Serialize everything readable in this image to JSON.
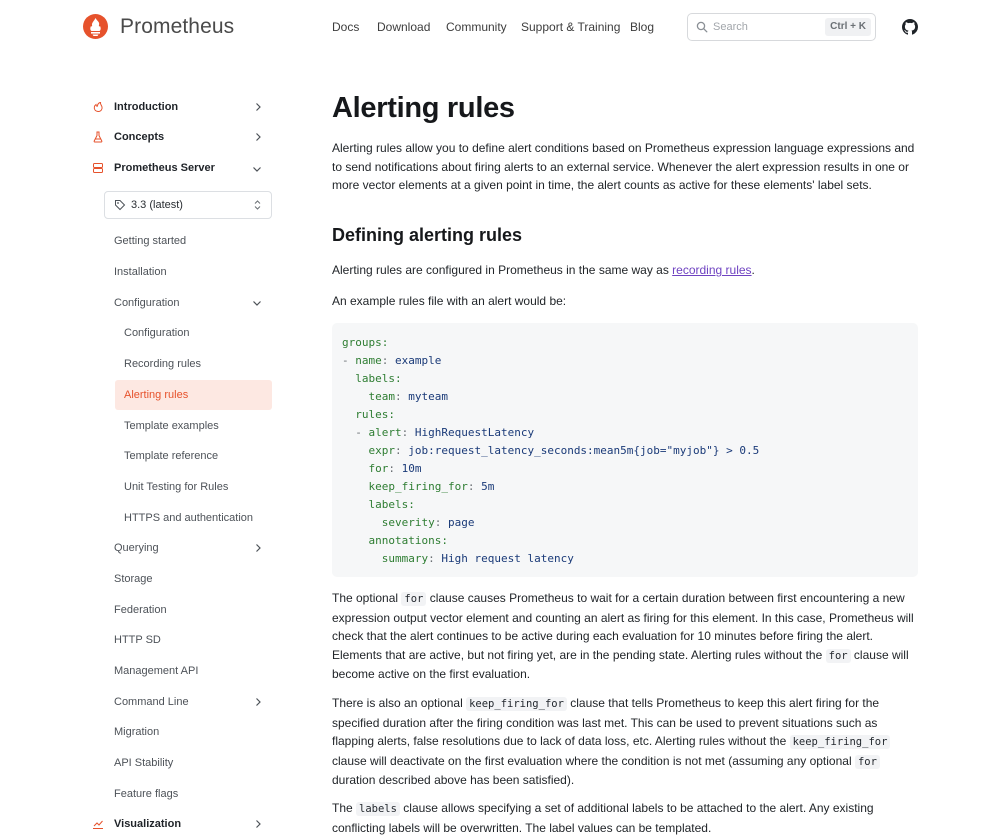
{
  "header": {
    "brand": "Prometheus",
    "nav": [
      "Docs",
      "Download",
      "Community",
      "Support & Training",
      "Blog"
    ],
    "search_placeholder": "Search",
    "search_shortcut": "Ctrl + K"
  },
  "sidebar": {
    "top": [
      {
        "label": "Introduction",
        "icon": "flame-icon"
      },
      {
        "label": "Concepts",
        "icon": "flask-icon"
      },
      {
        "label": "Prometheus Server",
        "icon": "server-icon"
      }
    ],
    "version": "3.3 (latest)",
    "items": [
      "Getting started",
      "Installation",
      "Configuration"
    ],
    "config_items": [
      "Configuration",
      "Recording rules",
      "Alerting rules",
      "Template examples",
      "Template reference",
      "Unit Testing for Rules",
      "HTTPS and authentication"
    ],
    "active": "Alerting rules",
    "rest": [
      "Querying",
      "Storage",
      "Federation",
      "HTTP SD",
      "Management API",
      "Command Line",
      "Migration",
      "API Stability",
      "Feature flags"
    ],
    "bottom": "Visualization"
  },
  "content": {
    "title": "Alerting rules",
    "intro": "Alerting rules allow you to define alert conditions based on Prometheus expression language expressions and to send notifications about firing alerts to an external service. Whenever the alert expression results in one or more vector elements at a given point in time, the alert counts as active for these elements' label sets.",
    "h2": "Defining alerting rules",
    "p1_pre": "Alerting rules are configured in Prometheus in the same way as ",
    "p1_link": "recording rules",
    "p1_post": ".",
    "p2": "An example rules file with an alert would be:",
    "code": {
      "l1": "groups:",
      "l2a": "- ",
      "l2b": "name",
      "l2c": ": ",
      "l2d": "example",
      "l3": "labels:",
      "l4a": "team",
      "l4b": "myteam",
      "l5": "rules:",
      "l6a": "- ",
      "l6b": "alert",
      "l6c": "HighRequestLatency",
      "l7a": "expr",
      "l7b": "job:request_latency_seconds:mean5m{job=\"myjob\"} > 0.5",
      "l8a": "for",
      "l8b": "10m",
      "l9a": "keep_firing_for",
      "l9b": "5m",
      "l10": "labels:",
      "l11a": "severity",
      "l11b": "page",
      "l12": "annotations:",
      "l13a": "summary",
      "l13b": "High request latency"
    },
    "p3a": "The optional ",
    "p3code": "for",
    "p3b": " clause causes Prometheus to wait for a certain duration between first encountering a new expression output vector element and counting an alert as firing for this element. In this case, Prometheus will check that the alert continues to be active during each evaluation for 10 minutes before firing the alert. Elements that are active, but not firing yet, are in the pending state. Alerting rules without the ",
    "p3code2": "for",
    "p3c": " clause will become active on the first evaluation.",
    "p4a": "There is also an optional ",
    "p4code": "keep_firing_for",
    "p4b": " clause that tells Prometheus to keep this alert firing for the specified duration after the firing condition was last met. This can be used to prevent situations such as flapping alerts, false resolutions due to lack of data loss, etc. Alerting rules without the ",
    "p4code2": "keep_firing_for",
    "p4c": " clause will deactivate on the first evaluation where the condition is not met (assuming any optional ",
    "p4code3": "for",
    "p4d": " duration described above has been satisfied).",
    "p5a": "The ",
    "p5code": "labels",
    "p5b": " clause allows specifying a set of additional labels to be attached to the alert. Any existing conflicting labels will be overwritten. The label values can be templated."
  },
  "colors": {
    "accent": "#e6522c",
    "active_bg": "#fde8e2",
    "link": "#6f42c1"
  }
}
